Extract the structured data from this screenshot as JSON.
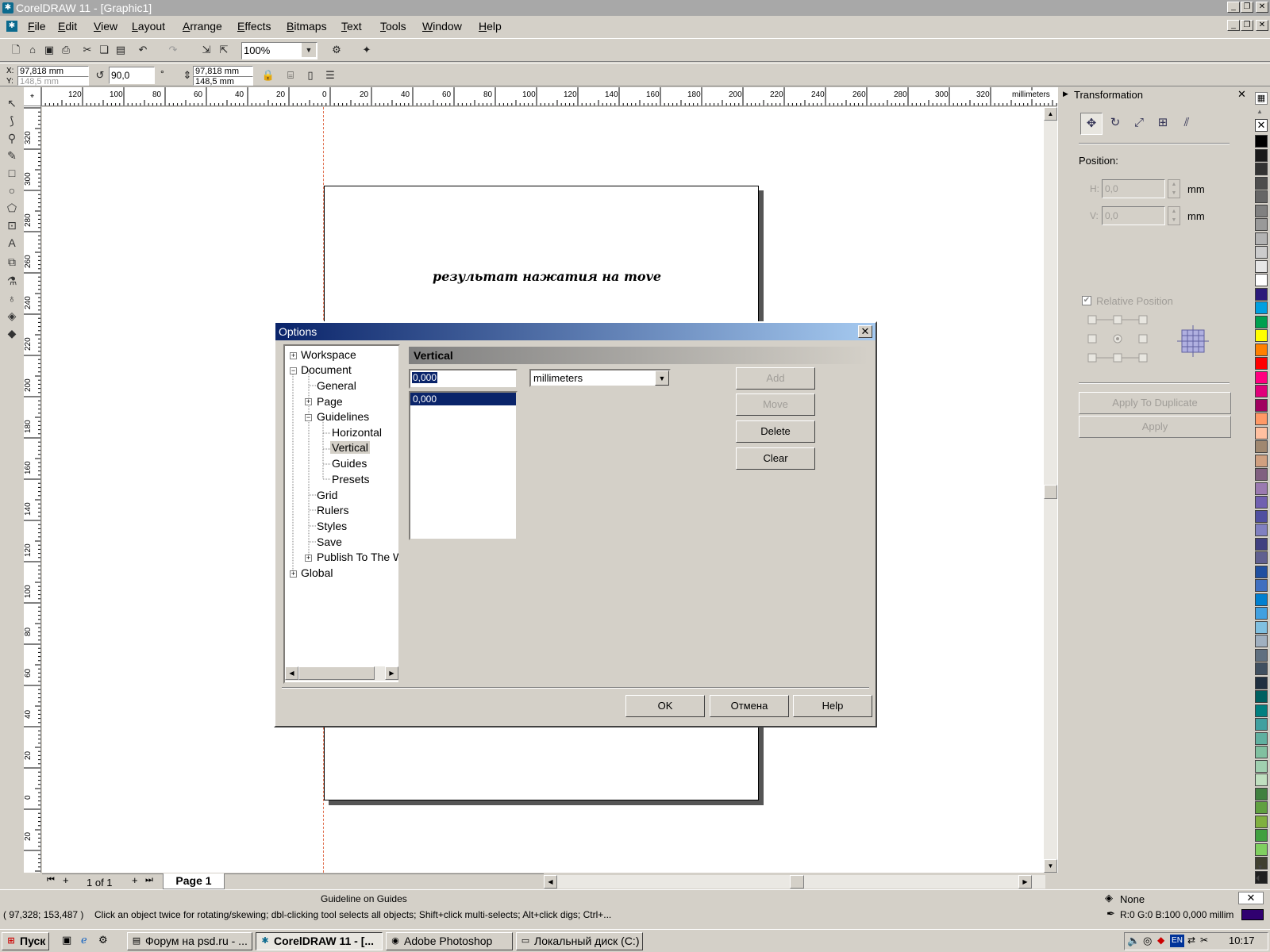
{
  "window": {
    "title": "CorelDRAW 11 - [Graphic1]",
    "app_icon": "corel-icon"
  },
  "menu": [
    "File",
    "Edit",
    "View",
    "Layout",
    "Arrange",
    "Effects",
    "Bitmaps",
    "Text",
    "Tools",
    "Window",
    "Help"
  ],
  "toolbar": {
    "zoom_value": "100%"
  },
  "property_bar": {
    "x_label": "X:",
    "x_value": "97,818 mm",
    "y_label": "Y:",
    "y_value": "148,5 mm",
    "rotation_value": "90,0",
    "degree_symbol": "°",
    "w_value": "97,818 mm",
    "h_value": "148,5 mm"
  },
  "ruler": {
    "unit": "millimeters",
    "h_ticks": [
      "120",
      "100",
      "80",
      "60",
      "40",
      "20",
      "0",
      "20",
      "40",
      "60",
      "80",
      "100",
      "120",
      "140",
      "160",
      "180",
      "200",
      "220",
      "240",
      "260",
      "280",
      "300",
      "320"
    ],
    "v_ticks": [
      "320",
      "300",
      "280",
      "260",
      "240",
      "220",
      "200",
      "180",
      "160",
      "140",
      "120",
      "100",
      "80",
      "60",
      "40",
      "20",
      "0",
      "20"
    ]
  },
  "canvas": {
    "page_text": "результат нажатия на move"
  },
  "page_nav": {
    "counter": "1 of 1",
    "tab": "Page 1"
  },
  "docker": {
    "title": "Transformation",
    "position_label": "Position:",
    "h_label": "H:",
    "h_value": "0,0",
    "v_label": "V:",
    "v_value": "0,0",
    "unit": "mm",
    "relative_position": "Relative Position",
    "apply_duplicate": "Apply To Duplicate",
    "apply": "Apply"
  },
  "palette": {
    "colors": [
      "#000000",
      "#1a1a1a",
      "#333333",
      "#4d4d4d",
      "#666666",
      "#808080",
      "#999999",
      "#b3b3b3",
      "#cccccc",
      "#e6e6e6",
      "#ffffff",
      "#2b1a7a",
      "#00a0e0",
      "#00a050",
      "#ffff00",
      "#ff8000",
      "#ff0000",
      "#ff0080",
      "#e0007a",
      "#a00060",
      "#ff9966",
      "#ffc0a0",
      "#a08870",
      "#d0a080",
      "#806080",
      "#9a7ab0",
      "#7060b0",
      "#5050a0",
      "#8080c0",
      "#404080",
      "#606090",
      "#2050a0",
      "#4070c0",
      "#0080d0",
      "#40a0e0",
      "#80c0e0",
      "#a0b0c0",
      "#607080",
      "#405060",
      "#203040",
      "#006060",
      "#008080",
      "#40a0a0",
      "#60b0a0",
      "#80c0a0",
      "#a0d0b0",
      "#c0e0c0",
      "#408040",
      "#60a040",
      "#80b040",
      "#40a040",
      "#80d060",
      "#404030",
      "#202020"
    ]
  },
  "status": {
    "line1": "Guideline on Guides",
    "coords": "( 97,328; 153,487 )",
    "hint": "Click an object twice for rotating/skewing; dbl-clicking tool selects all objects; Shift+click multi-selects; Alt+click digs; Ctrl+...",
    "fill_label": "None",
    "outline_label": "R:0 G:0 B:100  0,000 millim"
  },
  "taskbar": {
    "start": "Пуск",
    "tasks": [
      "Форум на psd.ru - ...",
      "CorelDRAW 11 - [...",
      "Adobe Photoshop",
      "Локальный диск (C:)"
    ],
    "tray_lang": "EN",
    "clock": "10:17"
  },
  "dialog": {
    "title": "Options",
    "tree": [
      {
        "label": "Workspace",
        "expander": "+"
      },
      {
        "label": "Document",
        "expander": "−"
      },
      {
        "label": "General"
      },
      {
        "label": "Page",
        "expander": "+"
      },
      {
        "label": "Guidelines",
        "expander": "−"
      },
      {
        "label": "Horizontal"
      },
      {
        "label": "Vertical"
      },
      {
        "label": "Guides"
      },
      {
        "label": "Presets"
      },
      {
        "label": "Grid"
      },
      {
        "label": "Rulers"
      },
      {
        "label": "Styles"
      },
      {
        "label": "Save"
      },
      {
        "label": "Publish To The W",
        "expander": "+"
      },
      {
        "label": "Global",
        "expander": "+"
      }
    ],
    "section_title": "Vertical",
    "value_input": "0,000",
    "unit_select": "millimeters",
    "list_items": [
      "0,000"
    ],
    "buttons": {
      "add": "Add",
      "move": "Move",
      "delete": "Delete",
      "clear": "Clear"
    },
    "footer": {
      "ok": "OK",
      "cancel": "Отмена",
      "help": "Help"
    }
  }
}
